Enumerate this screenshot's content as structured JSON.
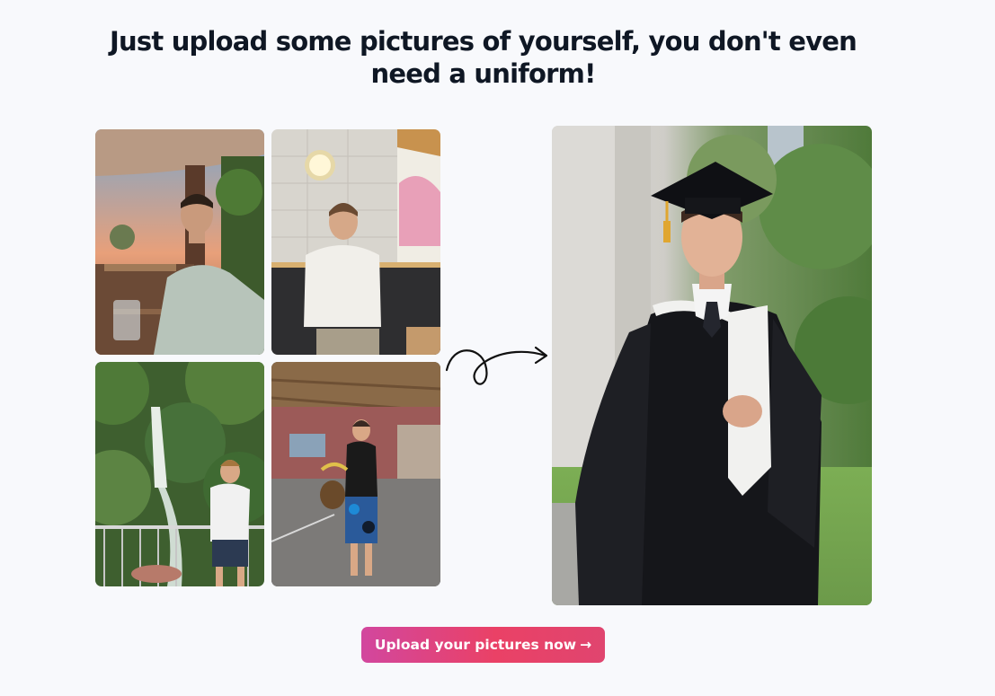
{
  "headline": "Just upload some pictures of yourself, you don't even need a uniform!",
  "cta": {
    "label": "Upload your pictures now",
    "icon": "arrow-right-icon",
    "arrow_glyph": "→",
    "gradient_colors": [
      "#d2479e",
      "#ea4166"
    ]
  },
  "input_photos": [
    {
      "scene": "outdoor restaurant terrace at sunset"
    },
    {
      "scene": "cafe bench with white tiled wall"
    },
    {
      "scene": "jungle waterfall viewpoint"
    },
    {
      "scene": "covered market hall"
    }
  ],
  "result_photo": {
    "scene": "graduation portrait in cap and gown"
  },
  "transition_icon": "curly-arrow-icon"
}
